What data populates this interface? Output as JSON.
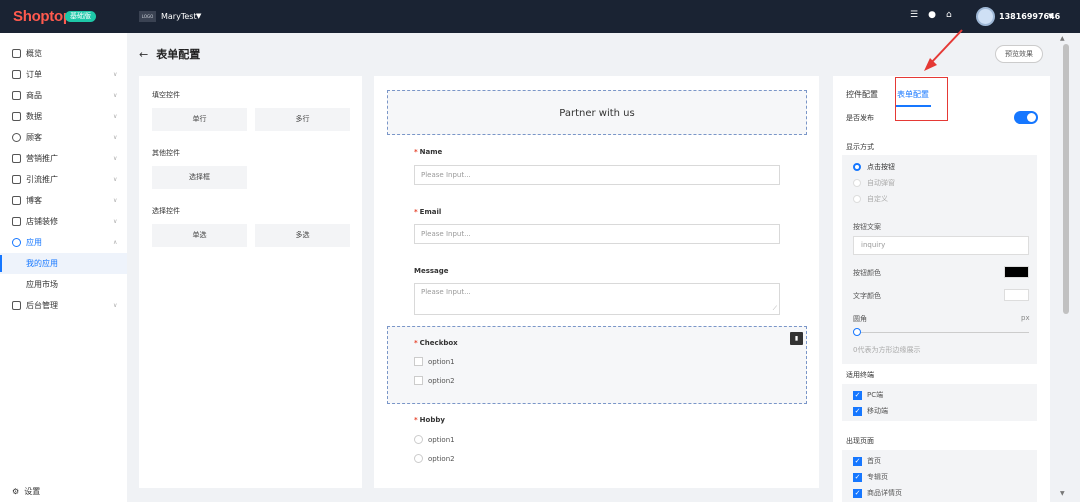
{
  "topbar": {
    "logo": "Shoptop",
    "edition": "基础版",
    "store_logo": "LOGO",
    "store_name": "MaryTest",
    "phone": "13816997646"
  },
  "sidebar": {
    "items": [
      {
        "label": "概览"
      },
      {
        "label": "订单"
      },
      {
        "label": "商品"
      },
      {
        "label": "数据"
      },
      {
        "label": "顾客"
      },
      {
        "label": "营销推广"
      },
      {
        "label": "引流推广"
      },
      {
        "label": "博客"
      },
      {
        "label": "店铺装修"
      },
      {
        "label": "应用"
      },
      {
        "label": "我的应用"
      },
      {
        "label": "应用市场"
      },
      {
        "label": "后台管理"
      }
    ],
    "settings": "设置"
  },
  "page": {
    "back": "←",
    "title": "表单配置",
    "preview": "预览效果"
  },
  "controls": {
    "group1": "填空控件",
    "single_line": "单行",
    "multi_line": "多行",
    "group2": "其他控件",
    "select_box": "选择框",
    "group3": "选择控件",
    "single_choice": "单选",
    "multi_choice": "多选"
  },
  "form": {
    "banner": "Partner with us",
    "name_label": "Name",
    "name_placeholder": "Please Input...",
    "email_label": "Email",
    "email_placeholder": "Please Input...",
    "message_label": "Message",
    "message_placeholder": "Please Input...",
    "checkbox_label": "Checkbox",
    "checkbox_options": [
      "option1",
      "option2"
    ],
    "hobby_label": "Hobby",
    "hobby_options": [
      "option1",
      "option2"
    ],
    "required_mark": "*"
  },
  "settings_panel": {
    "tab_control": "控件配置",
    "tab_form": "表单配置",
    "publish_label": "是否发布",
    "publish_on": true,
    "display_mode_label": "显示方式",
    "display_options": [
      "点击按钮",
      "自动弹窗",
      "自定义"
    ],
    "display_selected": "点击按钮",
    "button_text_label": "按钮文案",
    "button_text_value": "inquiry",
    "button_color_label": "按钮颜色",
    "button_color": "#000000",
    "text_color_label": "文字颜色",
    "text_color": "#ffffff",
    "radius_label": "圆角",
    "radius_unit": "px",
    "radius_value": 0,
    "radius_hint": "0代表为方形边缘展示",
    "terminal_label": "适用终端",
    "terminals": [
      "PC端",
      "移动端"
    ],
    "pages_label": "出现页面",
    "pages": [
      "首页",
      "专辑页",
      "商品详情页"
    ]
  },
  "colors": {
    "accent": "#1677ff",
    "topbar": "#1a2333",
    "brand": "#ff5a4e",
    "annotation": "#e53935"
  }
}
